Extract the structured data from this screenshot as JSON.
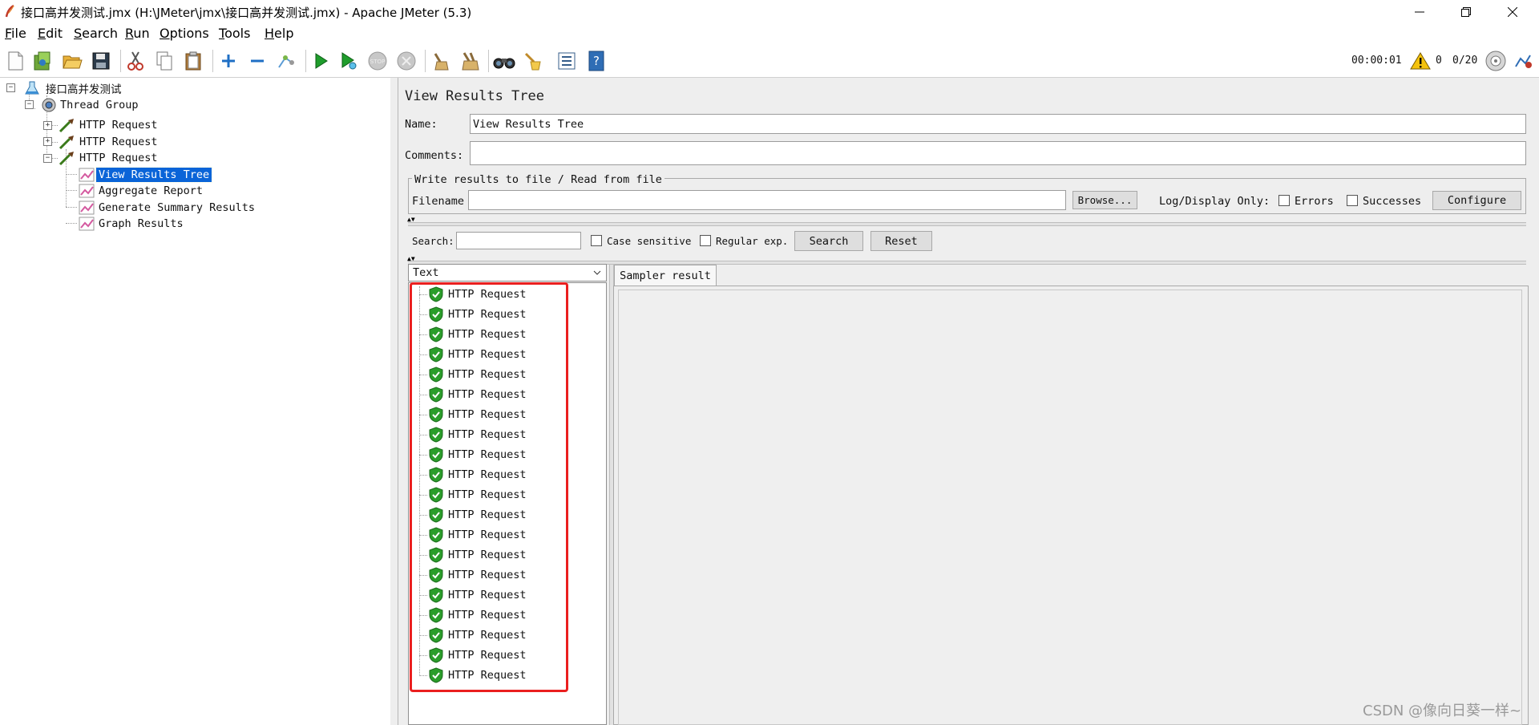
{
  "window": {
    "title": "接口高并发测试.jmx (H:\\JMeter\\jmx\\接口高并发测试.jmx) - Apache JMeter (5.3)"
  },
  "menu": {
    "items": [
      {
        "mnemonic": "F",
        "rest": "ile"
      },
      {
        "mnemonic": "E",
        "rest": "dit"
      },
      {
        "mnemonic": "S",
        "rest": "earch"
      },
      {
        "mnemonic": "R",
        "rest": "un"
      },
      {
        "mnemonic": "O",
        "rest": "ptions"
      },
      {
        "mnemonic": "T",
        "rest": "ools"
      },
      {
        "mnemonic": "H",
        "rest": "elp"
      }
    ]
  },
  "toolbar": {
    "elapsed": "00:00:01",
    "warning_count": "0",
    "threads": "0/20"
  },
  "tree": {
    "root": "接口高并发测试",
    "thread_group": "Thread Group",
    "requests": [
      "HTTP Request",
      "HTTP Request",
      "HTTP Request"
    ],
    "listeners": [
      "View Results Tree",
      "Aggregate Report",
      "Generate Summary Results",
      "Graph Results"
    ]
  },
  "panel": {
    "title": "View Results Tree",
    "name_label": "Name:",
    "name_value": "View Results Tree",
    "comments_label": "Comments:",
    "comments_value": "",
    "file_group_legend": "Write results to file / Read from file",
    "filename_label": "Filename",
    "filename_value": "",
    "browse_button": "Browse...",
    "log_display_label": "Log/Display Only:",
    "errors_label": "Errors",
    "successes_label": "Successes",
    "configure_button": "Configure",
    "search_label": "Search:",
    "search_value": "",
    "case_sensitive_label": "Case sensitive",
    "regex_label": "Regular exp.",
    "search_button": "Search",
    "reset_button": "Reset",
    "renderer_select": "Text",
    "sampler_tab": "Sampler result"
  },
  "results": [
    "HTTP Request",
    "HTTP Request",
    "HTTP Request",
    "HTTP Request",
    "HTTP Request",
    "HTTP Request",
    "HTTP Request",
    "HTTP Request",
    "HTTP Request",
    "HTTP Request",
    "HTTP Request",
    "HTTP Request",
    "HTTP Request",
    "HTTP Request",
    "HTTP Request",
    "HTTP Request",
    "HTTP Request",
    "HTTP Request",
    "HTTP Request",
    "HTTP Request"
  ],
  "watermark": "CSDN @像向日葵一样~",
  "colors": {
    "selection": "#0a64d8",
    "highlight_box": "#ea1f1f",
    "success_shield": "#2a9d2a",
    "panel_bg": "#eeeeee"
  },
  "icons": {
    "toolbar": [
      "new-icon",
      "templates-icon",
      "open-icon",
      "save-icon",
      "cut-icon",
      "copy-icon",
      "paste-icon",
      "expand-icon",
      "collapse-icon",
      "toggle-icon",
      "start-icon",
      "start-no-pause-icon",
      "stop-icon",
      "shutdown-icon",
      "clear-icon",
      "clear-all-icon",
      "search-icon",
      "reset-search-icon",
      "function-helper-icon",
      "help-icon"
    ],
    "result_item": "success-shield-icon"
  }
}
